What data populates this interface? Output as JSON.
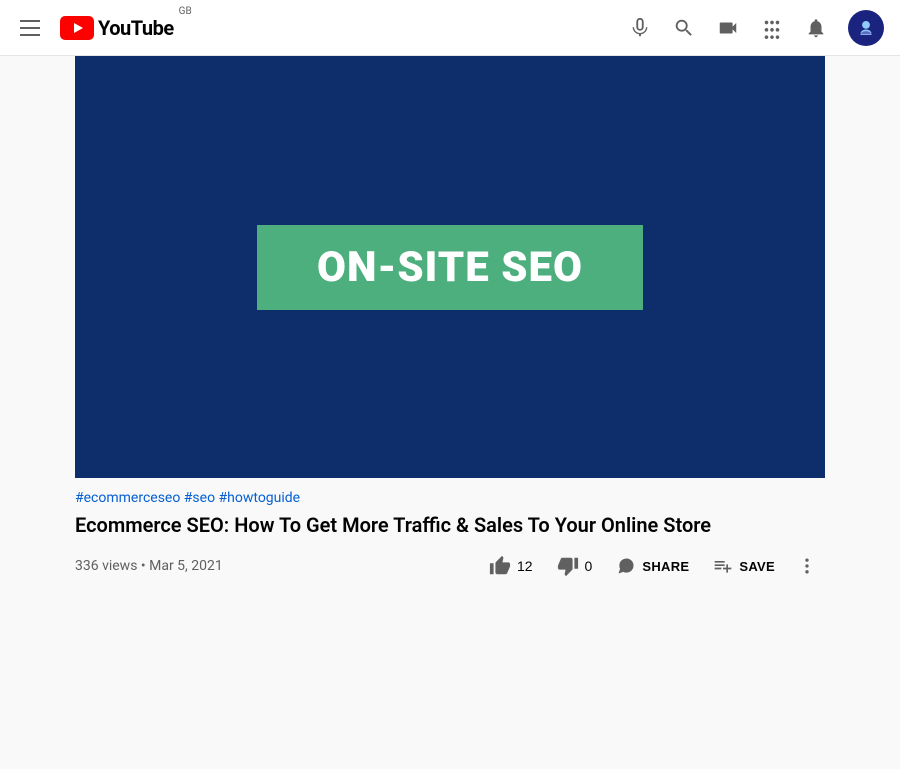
{
  "header": {
    "logo_text": "YouTube",
    "country": "GB",
    "menu_icon": "hamburger",
    "icons": {
      "mic": "🎤",
      "search": "🔍",
      "camera": "📹",
      "apps": "⋮⋮⋮",
      "bell": "🔔"
    }
  },
  "video": {
    "banner_text": "ON-SITE SEO",
    "banner_bg": "#4caf7d",
    "player_bg": "#0d2d6b",
    "tags": "#ecommerceseo #seo #howtoguide",
    "title": "Ecommerce SEO: How To Get More Traffic & Sales To Your Online Store",
    "views": "336 views",
    "date": "Mar 5, 2021",
    "stats": "336 views • Mar 5, 2021",
    "likes": "12",
    "dislikes": "0",
    "share_label": "SHARE",
    "save_label": "SAVE"
  }
}
